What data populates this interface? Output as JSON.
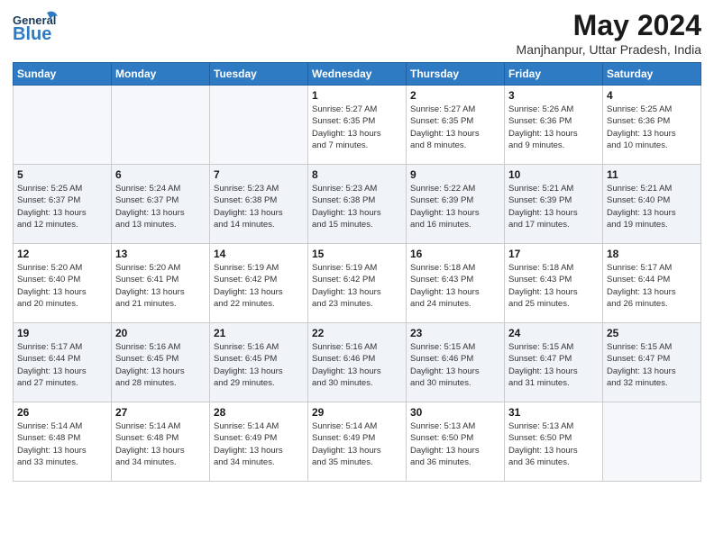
{
  "header": {
    "logo_general": "General",
    "logo_blue": "Blue",
    "title": "May 2024",
    "subtitle": "Manjhanpur, Uttar Pradesh, India"
  },
  "days_of_week": [
    "Sunday",
    "Monday",
    "Tuesday",
    "Wednesday",
    "Thursday",
    "Friday",
    "Saturday"
  ],
  "weeks": [
    [
      {
        "day": "",
        "info": ""
      },
      {
        "day": "",
        "info": ""
      },
      {
        "day": "",
        "info": ""
      },
      {
        "day": "1",
        "info": "Sunrise: 5:27 AM\nSunset: 6:35 PM\nDaylight: 13 hours\nand 7 minutes."
      },
      {
        "day": "2",
        "info": "Sunrise: 5:27 AM\nSunset: 6:35 PM\nDaylight: 13 hours\nand 8 minutes."
      },
      {
        "day": "3",
        "info": "Sunrise: 5:26 AM\nSunset: 6:36 PM\nDaylight: 13 hours\nand 9 minutes."
      },
      {
        "day": "4",
        "info": "Sunrise: 5:25 AM\nSunset: 6:36 PM\nDaylight: 13 hours\nand 10 minutes."
      }
    ],
    [
      {
        "day": "5",
        "info": "Sunrise: 5:25 AM\nSunset: 6:37 PM\nDaylight: 13 hours\nand 12 minutes."
      },
      {
        "day": "6",
        "info": "Sunrise: 5:24 AM\nSunset: 6:37 PM\nDaylight: 13 hours\nand 13 minutes."
      },
      {
        "day": "7",
        "info": "Sunrise: 5:23 AM\nSunset: 6:38 PM\nDaylight: 13 hours\nand 14 minutes."
      },
      {
        "day": "8",
        "info": "Sunrise: 5:23 AM\nSunset: 6:38 PM\nDaylight: 13 hours\nand 15 minutes."
      },
      {
        "day": "9",
        "info": "Sunrise: 5:22 AM\nSunset: 6:39 PM\nDaylight: 13 hours\nand 16 minutes."
      },
      {
        "day": "10",
        "info": "Sunrise: 5:21 AM\nSunset: 6:39 PM\nDaylight: 13 hours\nand 17 minutes."
      },
      {
        "day": "11",
        "info": "Sunrise: 5:21 AM\nSunset: 6:40 PM\nDaylight: 13 hours\nand 19 minutes."
      }
    ],
    [
      {
        "day": "12",
        "info": "Sunrise: 5:20 AM\nSunset: 6:40 PM\nDaylight: 13 hours\nand 20 minutes."
      },
      {
        "day": "13",
        "info": "Sunrise: 5:20 AM\nSunset: 6:41 PM\nDaylight: 13 hours\nand 21 minutes."
      },
      {
        "day": "14",
        "info": "Sunrise: 5:19 AM\nSunset: 6:42 PM\nDaylight: 13 hours\nand 22 minutes."
      },
      {
        "day": "15",
        "info": "Sunrise: 5:19 AM\nSunset: 6:42 PM\nDaylight: 13 hours\nand 23 minutes."
      },
      {
        "day": "16",
        "info": "Sunrise: 5:18 AM\nSunset: 6:43 PM\nDaylight: 13 hours\nand 24 minutes."
      },
      {
        "day": "17",
        "info": "Sunrise: 5:18 AM\nSunset: 6:43 PM\nDaylight: 13 hours\nand 25 minutes."
      },
      {
        "day": "18",
        "info": "Sunrise: 5:17 AM\nSunset: 6:44 PM\nDaylight: 13 hours\nand 26 minutes."
      }
    ],
    [
      {
        "day": "19",
        "info": "Sunrise: 5:17 AM\nSunset: 6:44 PM\nDaylight: 13 hours\nand 27 minutes."
      },
      {
        "day": "20",
        "info": "Sunrise: 5:16 AM\nSunset: 6:45 PM\nDaylight: 13 hours\nand 28 minutes."
      },
      {
        "day": "21",
        "info": "Sunrise: 5:16 AM\nSunset: 6:45 PM\nDaylight: 13 hours\nand 29 minutes."
      },
      {
        "day": "22",
        "info": "Sunrise: 5:16 AM\nSunset: 6:46 PM\nDaylight: 13 hours\nand 30 minutes."
      },
      {
        "day": "23",
        "info": "Sunrise: 5:15 AM\nSunset: 6:46 PM\nDaylight: 13 hours\nand 30 minutes."
      },
      {
        "day": "24",
        "info": "Sunrise: 5:15 AM\nSunset: 6:47 PM\nDaylight: 13 hours\nand 31 minutes."
      },
      {
        "day": "25",
        "info": "Sunrise: 5:15 AM\nSunset: 6:47 PM\nDaylight: 13 hours\nand 32 minutes."
      }
    ],
    [
      {
        "day": "26",
        "info": "Sunrise: 5:14 AM\nSunset: 6:48 PM\nDaylight: 13 hours\nand 33 minutes."
      },
      {
        "day": "27",
        "info": "Sunrise: 5:14 AM\nSunset: 6:48 PM\nDaylight: 13 hours\nand 34 minutes."
      },
      {
        "day": "28",
        "info": "Sunrise: 5:14 AM\nSunset: 6:49 PM\nDaylight: 13 hours\nand 34 minutes."
      },
      {
        "day": "29",
        "info": "Sunrise: 5:14 AM\nSunset: 6:49 PM\nDaylight: 13 hours\nand 35 minutes."
      },
      {
        "day": "30",
        "info": "Sunrise: 5:13 AM\nSunset: 6:50 PM\nDaylight: 13 hours\nand 36 minutes."
      },
      {
        "day": "31",
        "info": "Sunrise: 5:13 AM\nSunset: 6:50 PM\nDaylight: 13 hours\nand 36 minutes."
      },
      {
        "day": "",
        "info": ""
      }
    ]
  ]
}
